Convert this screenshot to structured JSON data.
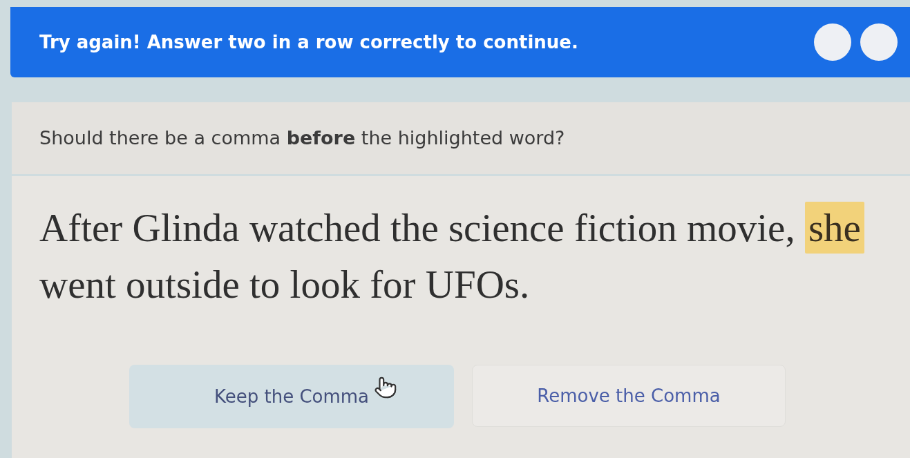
{
  "banner": {
    "message": "Try again! Answer two in a row correctly to continue.",
    "streak": [
      {
        "filled": false
      },
      {
        "filled": false
      }
    ]
  },
  "question": {
    "prompt": "Should there be a comma **before** the highlighted word?"
  },
  "passage": {
    "text_before": "After Glinda watched the science fiction movie,",
    "highlighted": "she",
    "text_after": "went outside to look for UFOs."
  },
  "answers": [
    {
      "label": "Keep the Comma",
      "hovered": true
    },
    {
      "label": "Remove the Comma",
      "hovered": false
    }
  ]
}
